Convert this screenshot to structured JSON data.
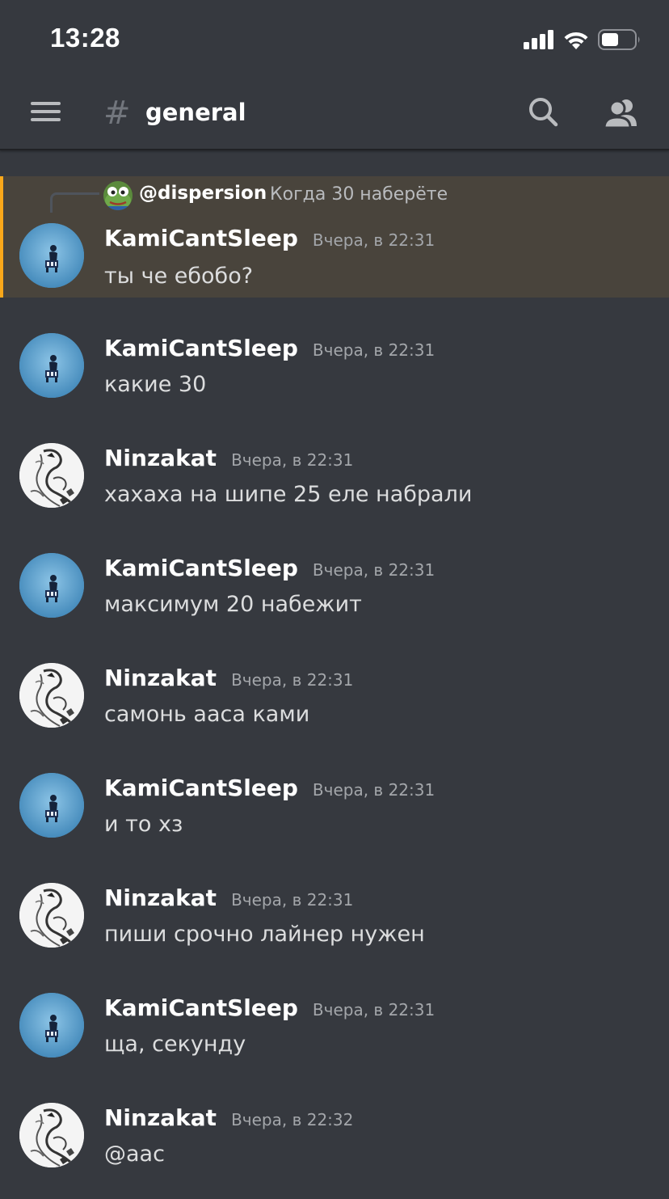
{
  "status_bar": {
    "time": "13:28"
  },
  "header": {
    "hash_symbol": "#",
    "channel_name": "general"
  },
  "reply": {
    "author": "@dispersion",
    "preview": "Когда 30 наберёте"
  },
  "messages": [
    {
      "author": "KamiCantSleep",
      "time": "Вчера, в 22:31",
      "text": "ты че ебобо?",
      "avatar": "kami"
    },
    {
      "author": "KamiCantSleep",
      "time": "Вчера, в 22:31",
      "text": "какие 30",
      "avatar": "kami"
    },
    {
      "author": "Ninzakat",
      "time": "Вчера, в 22:31",
      "text": "хахаха на шипе 25 еле набрали",
      "avatar": "ninza"
    },
    {
      "author": "KamiCantSleep",
      "time": "Вчера, в 22:31",
      "text": "максимум 20 набежит",
      "avatar": "kami"
    },
    {
      "author": "Ninzakat",
      "time": "Вчера, в 22:31",
      "text": "самонь ааса ками",
      "avatar": "ninza"
    },
    {
      "author": "KamiCantSleep",
      "time": "Вчера, в 22:31",
      "text": "и то хз",
      "avatar": "kami"
    },
    {
      "author": "Ninzakat",
      "time": "Вчера, в 22:31",
      "text": "пиши срочно лайнер нужен",
      "avatar": "ninza"
    },
    {
      "author": "KamiCantSleep",
      "time": "Вчера, в 22:31",
      "text": "ща, секунду",
      "avatar": "kami"
    },
    {
      "author": "Ninzakat",
      "time": "Вчера, в 22:32",
      "text": "@аас",
      "avatar": "ninza"
    }
  ],
  "colors": {
    "background": "#36393f",
    "highlight": "#49443c",
    "mention_bar": "#faa81a",
    "username": "#ffffff",
    "text": "#dcddde",
    "timestamp": "#a3a6aa"
  },
  "icons": {
    "menu": "hamburger-menu-icon",
    "channel": "hash-icon",
    "search": "search-icon",
    "members": "members-icon",
    "signal": "cellular-signal-icon",
    "wifi": "wifi-icon",
    "battery": "battery-icon"
  }
}
